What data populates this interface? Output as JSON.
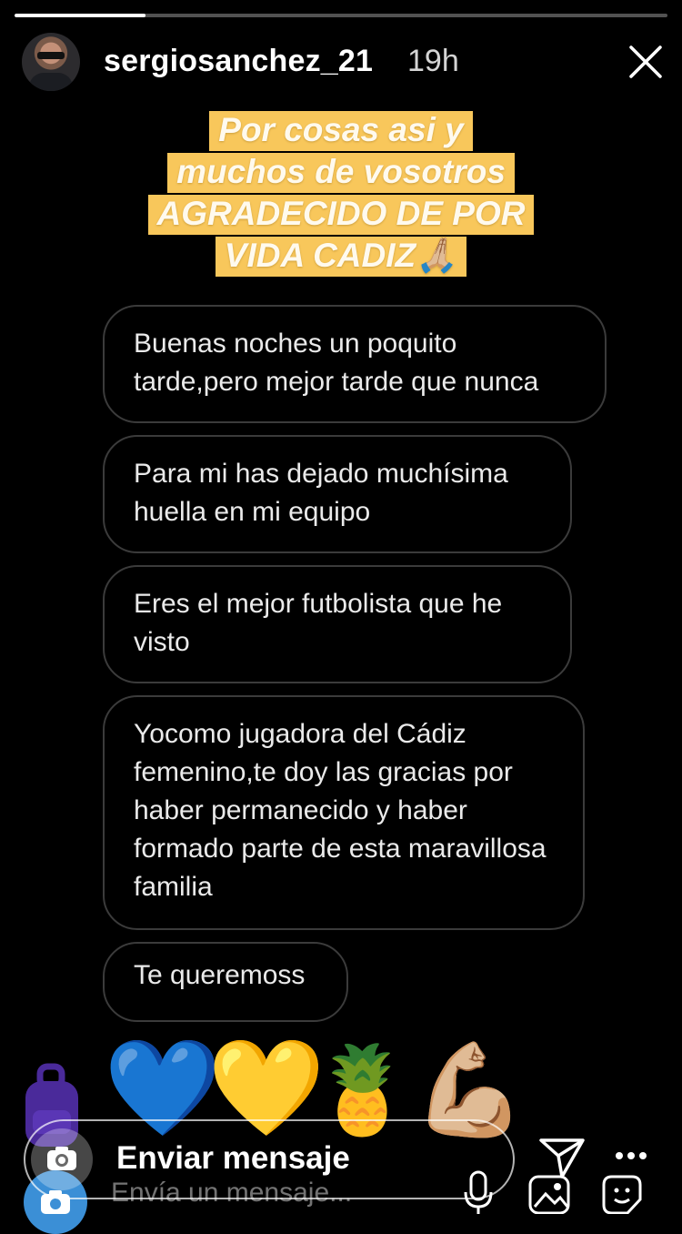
{
  "story": {
    "progress": 0.2,
    "username": "sergiosanchez_21",
    "time": "19h",
    "caption_lines": [
      "Por cosas asi y",
      "muchos de vosotros",
      "AGRADECIDO DE POR",
      "VIDA CADIZ🙏🏼"
    ]
  },
  "messages": [
    {
      "text": "Buenas noches un poquito tarde,pero mejor tarde que nunca"
    },
    {
      "text": "Para mi has dejado muchísima huella en mi equipo"
    },
    {
      "text": "Eres el mejor futbolista que he visto"
    },
    {
      "text": "Yocomo jugadora del Cádiz femenino,te doy las gracias por haber permanecido y haber formado parte de esta maravillosa familia"
    },
    {
      "text": "Te queremoss"
    }
  ],
  "stickers": [
    "💙",
    "💛",
    "🍍",
    "💪🏼"
  ],
  "reply_bar": {
    "label": "Enviar mensaje"
  },
  "underlying": {
    "placeholder": "Envía un mensaje..."
  },
  "colors": {
    "caption_bg": "#f8c75b",
    "bubble_border": "#3b3b3b",
    "background": "#000000"
  },
  "icons": [
    "camera-icon",
    "send-icon",
    "more-icon",
    "close-icon",
    "microphone-icon",
    "gallery-icon",
    "sticker-icon"
  ]
}
